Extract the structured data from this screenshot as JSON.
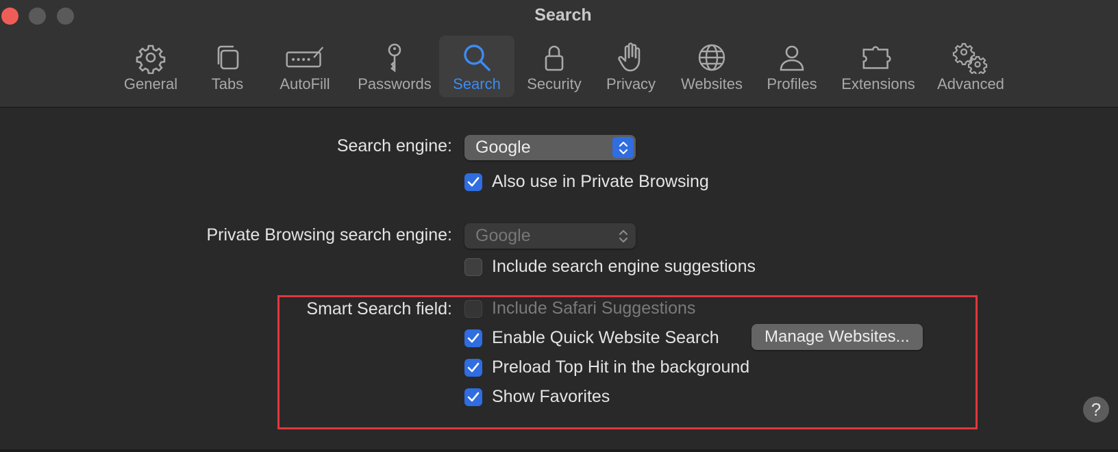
{
  "window": {
    "title": "Search"
  },
  "toolbar": {
    "items": [
      {
        "label": "General",
        "icon": "gear-icon"
      },
      {
        "label": "Tabs",
        "icon": "tabs-icon"
      },
      {
        "label": "AutoFill",
        "icon": "autofill-icon"
      },
      {
        "label": "Passwords",
        "icon": "key-icon"
      },
      {
        "label": "Search",
        "icon": "search-icon",
        "active": true
      },
      {
        "label": "Security",
        "icon": "lock-icon"
      },
      {
        "label": "Privacy",
        "icon": "hand-icon"
      },
      {
        "label": "Websites",
        "icon": "globe-icon"
      },
      {
        "label": "Profiles",
        "icon": "person-icon"
      },
      {
        "label": "Extensions",
        "icon": "puzzle-icon"
      },
      {
        "label": "Advanced",
        "icon": "gears-icon"
      }
    ]
  },
  "search_engine": {
    "label": "Search engine:",
    "value": "Google",
    "private_option": {
      "label": "Also use in Private Browsing",
      "checked": true
    }
  },
  "private_engine": {
    "label": "Private Browsing search engine:",
    "value": "Google",
    "disabled": true,
    "suggestions_option": {
      "label": "Include search engine suggestions",
      "checked": false
    }
  },
  "smart_search": {
    "label": "Smart Search field:",
    "options": [
      {
        "label": "Include Safari Suggestions",
        "checked": false,
        "disabled": true
      },
      {
        "label": "Enable Quick Website Search",
        "checked": true
      },
      {
        "label": "Preload Top Hit in the background",
        "checked": true
      },
      {
        "label": "Show Favorites",
        "checked": true
      }
    ],
    "manage_button": "Manage Websites..."
  },
  "help": {
    "label": "?"
  },
  "colors": {
    "accent": "#2f6de1",
    "active_tab": "#3d8bf2",
    "highlight": "#e0383e"
  }
}
